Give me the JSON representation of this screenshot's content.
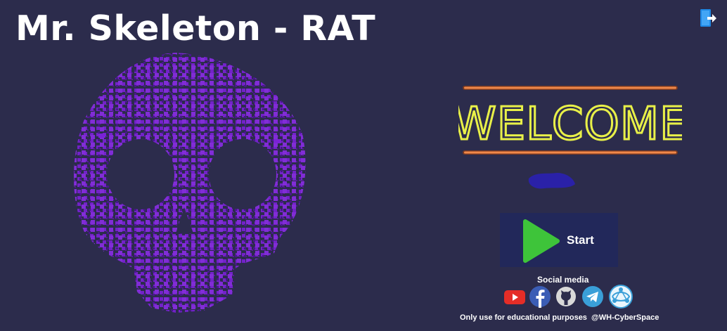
{
  "app": {
    "title": "Mr. Skeleton - RAT"
  },
  "colors": {
    "background": "#2c2c4c",
    "ascii_art": "#7a22d6",
    "neon_text": "#e8f048",
    "neon_bars": "#f0884a",
    "start_button_bg": "#22285a",
    "play_green": "#3ec43a"
  },
  "header": {
    "exit_icon": "exit-door-icon"
  },
  "welcome": {
    "sign_text": "WELCOME",
    "username": ""
  },
  "actions": {
    "start_label": "Start",
    "start_icon": "play-icon"
  },
  "social": {
    "heading": "Social media",
    "links": [
      {
        "icon": "youtube-icon"
      },
      {
        "icon": "facebook-icon"
      },
      {
        "icon": "github-icon"
      },
      {
        "icon": "telegram-icon"
      },
      {
        "icon": "network-icon"
      }
    ]
  },
  "footer": {
    "disclaimer": "Only use for educational purposes  @WH-CyberSpace"
  }
}
